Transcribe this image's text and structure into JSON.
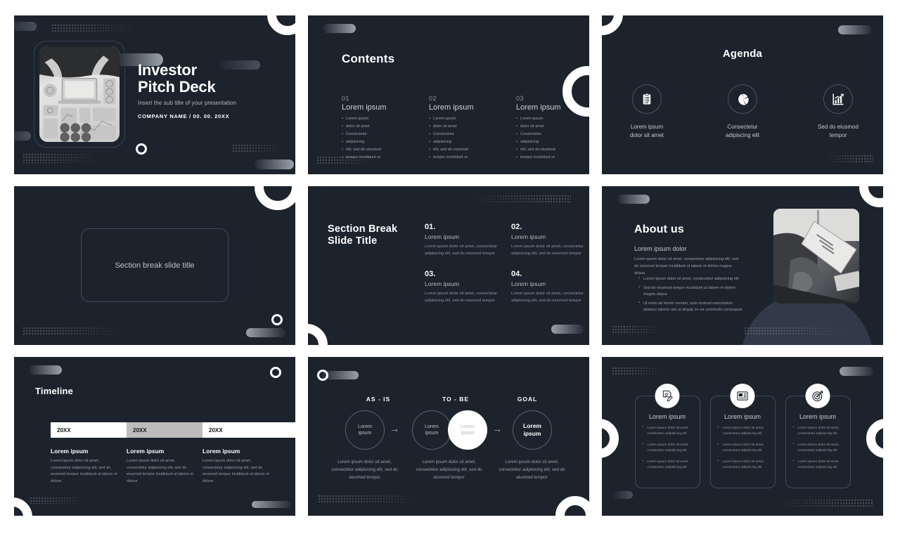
{
  "theme": {
    "slide_bg": "#1c232d",
    "page_bg": "#ffffff",
    "accent_white": "#ffffff",
    "muted_text": "#98a0ab"
  },
  "slide1": {
    "title_line1": "Investor",
    "title_line2": "Pitch Deck",
    "subtitle": "Insert the sub title of your presentation",
    "meta": "COMPANY NAME  /  00. 00. 20XX",
    "photo_alt": "person typing on laptop with charts"
  },
  "slide2": {
    "title": "Contents",
    "columns": [
      {
        "number": "01",
        "heading": "Lorem ipsum",
        "items": [
          "Lorem ipsum",
          "dolor sit amet",
          "Consectetur",
          "adipisicing",
          "elit, sed do eiusmod",
          "tempor incididunt ut"
        ]
      },
      {
        "number": "02",
        "heading": "Lorem ipsum",
        "items": [
          "Lorem ipsum",
          "dolor sit amet",
          "Consectetur",
          "adipisicing",
          "elit, sed do eiusmod",
          "tempor incididunt ut"
        ]
      },
      {
        "number": "03",
        "heading": "Lorem ipsum",
        "items": [
          "Lorem ipsum",
          "dolor sit amet",
          "Consectetur",
          "adipisicing",
          "elit, sed do eiusmod",
          "tempor incididunt ut"
        ]
      }
    ]
  },
  "slide3": {
    "title": "Agenda",
    "items": [
      {
        "icon": "clipboard-list-icon",
        "caption": "Lorem ipsum\ndolor sit amet"
      },
      {
        "icon": "pie-chart-icon",
        "caption": "Consectetur\nadipiscing elit"
      },
      {
        "icon": "bar-chart-growth-icon",
        "caption": "Sed do eiusmod\ntempor"
      }
    ]
  },
  "slide4": {
    "box_title": "Section break slide title"
  },
  "slide5": {
    "title_line1": "Section Break",
    "title_line2": "Slide Title",
    "items": [
      {
        "number": "01.",
        "heading": "Lorem ipsum",
        "body": "Lorem ipsum dolor sit amet, consectetur adipisicing elit, sed do eiusmod tempor"
      },
      {
        "number": "02.",
        "heading": "Lorem ipsum",
        "body": "Lorem ipsum dolor sit amet, consectetur adipisicing elit, sed do eiusmod tempor"
      },
      {
        "number": "03.",
        "heading": "Lorem ipsum",
        "body": "Lorem ipsum dolor sit amet, consectetur adipisicing elit, sed do eiusmod tempor"
      },
      {
        "number": "04.",
        "heading": "Lorem ipsum",
        "body": "Lorem ipsum dolor sit amet, consectetur adipisicing elit, sed do eiusmod tempor"
      }
    ]
  },
  "slide6": {
    "title": "About us",
    "subheading": "Lorem ipsum dolor",
    "paragraph": "Lorem ipsum dolor sit amet, consectetur adipisicing elit, sed do eiusmod tempor incididunt ut labore et dolore magna aliqua.",
    "bullets": [
      "Lorem ipsum dolor sit amet, consectetur adipisicing elit",
      "Sed do eiusmod tempor incididunt ut labore et dolore magna aliqua",
      "Ut enim ad minim veniam, quis nostrud exercitation ullamco laboris nisi ut aliquip ex ea commodo consequat."
    ],
    "photo_alt": "hands holding a tablet"
  },
  "slide7": {
    "title": "Timeline",
    "years": [
      "20XX",
      "20XX",
      "20XX"
    ],
    "columns": [
      {
        "heading": "Lorem ipsum",
        "body": "Lorem ipsum dolor sit amet, consectetur adipisicing elit, sed do eiusmod tempor incididunt ut labore et dolore"
      },
      {
        "heading": "Lorem ipsum",
        "body": "Lorem ipsum dolor sit amet, consectetur adipisicing elit, sed do eiusmod tempor incididunt ut labore et dolore"
      },
      {
        "heading": "Lorem ipsum",
        "body": "Lorem ipsum dolor sit amet, consectetur adipisicing elit, sed do eiusmod tempor incididunt ut labore et dolore"
      }
    ]
  },
  "slide8": {
    "labels": [
      "AS - IS",
      "TO - BE",
      "GOAL"
    ],
    "circles": [
      {
        "text": "Lorem\nipsum",
        "style": "outline"
      },
      {
        "text": "Lorem\nipsum",
        "style": "outline"
      },
      {
        "text": "Lorem\nipsum",
        "style": "filled"
      },
      {
        "text": "Lorem\nipsum",
        "style": "bold"
      }
    ],
    "captions": [
      "Lorem ipsum dolor sit amet, consectetur adipisicing elit, sed do eiusmod tempor",
      "Lorem ipsum dolor sit amet, consectetur adipisicing elit, sed do eiusmod tempor",
      "Lorem ipsum dolor sit amet, consectetur adipisicing elit, sed do eiusmod tempor"
    ],
    "arrow": "→"
  },
  "slide9": {
    "cards": [
      {
        "icon": "document-edit-icon",
        "heading": "Lorem ipsum",
        "items": [
          "Lorem ipsum dolor sit amet, consectetur adipisicing elit",
          "Lorem ipsum dolor sit amet, consectetur adipisicing elit",
          "Lorem ipsum dolor sit amet, consectetur adipisicing elit"
        ]
      },
      {
        "icon": "news-report-icon",
        "heading": "Lorem ipsum",
        "items": [
          "Lorem ipsum dolor sit amet, consectetur adipisicing elit",
          "Lorem ipsum dolor sit amet, consectetur adipisicing elit",
          "Lorem ipsum dolor sit amet, consectetur adipisicing elit"
        ]
      },
      {
        "icon": "target-dart-icon",
        "heading": "Lorem ipsum",
        "items": [
          "Lorem ipsum dolor sit amet, consectetur adipisicing elit",
          "Lorem ipsum dolor sit amet, consectetur adipisicing elit",
          "Lorem ipsum dolor sit amet, consectetur adipisicing elit"
        ]
      }
    ]
  }
}
